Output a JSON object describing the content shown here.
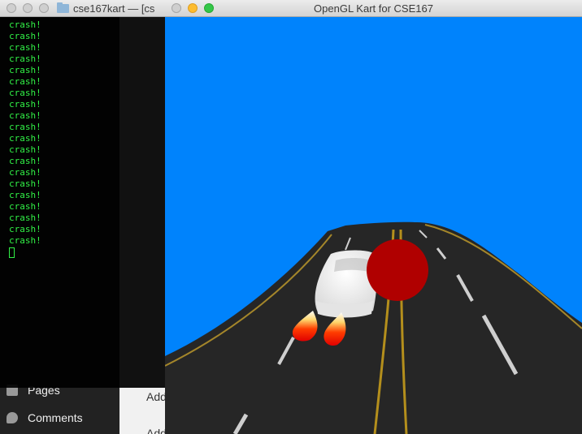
{
  "terminal": {
    "title": "cse167kart — [cs",
    "lines": [
      "crash!",
      "crash!",
      "crash!",
      "crash!",
      "crash!",
      "crash!",
      "crash!",
      "crash!",
      "crash!",
      "crash!",
      "crash!",
      "crash!",
      "crash!",
      "crash!",
      "crash!",
      "crash!",
      "crash!",
      "crash!",
      "crash!",
      "crash!"
    ],
    "text_color": "#31f046",
    "background": "#0a0a0a"
  },
  "background_app": {
    "menu_items": [
      {
        "label": "Pages",
        "icon": "pages-icon"
      },
      {
        "label": "Comments",
        "icon": "comments-icon"
      }
    ],
    "content_snippets": [
      "Add",
      "Add"
    ]
  },
  "gl_window": {
    "title": "OpenGL Kart for CSE167",
    "sky_color": "#0083fc",
    "road_color": "#262626",
    "ball_color": "#b00000",
    "car_color": "#ffffff"
  }
}
